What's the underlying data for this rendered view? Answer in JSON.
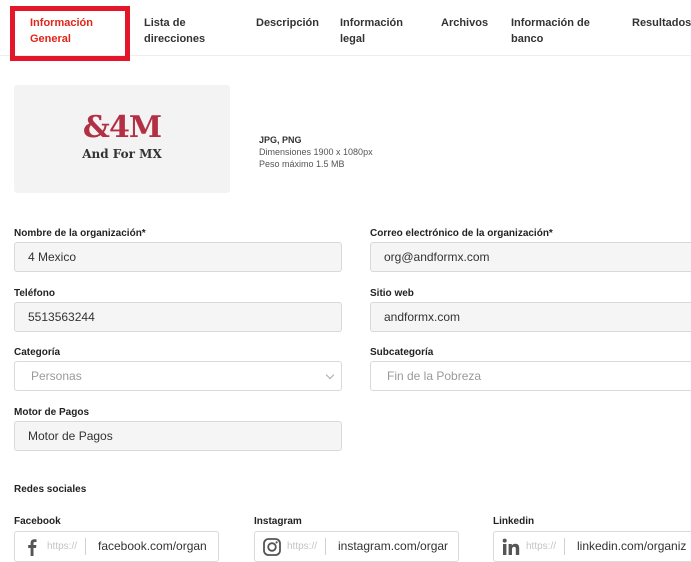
{
  "tabs": [
    {
      "line1": "Información",
      "line2": "General"
    },
    {
      "line1": "Lista de",
      "line2": "direcciones"
    },
    {
      "line1": "Descripción",
      "line2": ""
    },
    {
      "line1": "Información",
      "line2": "legal"
    },
    {
      "line1": "Archivos",
      "line2": ""
    },
    {
      "line1": "Información de",
      "line2": "banco"
    },
    {
      "line1": "Resultados",
      "line2": ""
    }
  ],
  "logo": {
    "mark": "&4M",
    "subtitle": "And For MX"
  },
  "file_info": {
    "formats": "JPG, PNG",
    "dimensions": "Dimensiones 1900 x 1080px",
    "max_size": "Peso máximo 1.5 MB"
  },
  "form": {
    "org_name": {
      "label": "Nombre de la organización*",
      "value": "4 Mexico"
    },
    "org_email": {
      "label": "Correo electrónico de la organización*",
      "value": "org@andformx.com"
    },
    "phone": {
      "label": "Teléfono",
      "value": "5513563244"
    },
    "website": {
      "label": "Sitio web",
      "value": "andformx.com"
    },
    "category": {
      "label": "Categoría",
      "value": "Personas"
    },
    "subcategory": {
      "label": "Subcategoría",
      "value": "Fin de la Pobreza"
    },
    "payment_engine": {
      "label": "Motor de Pagos",
      "value": "Motor de Pagos"
    }
  },
  "social": {
    "title": "Redes sociales",
    "facebook": {
      "label": "Facebook",
      "prefix": "https://",
      "value": "facebook.com/organ"
    },
    "instagram": {
      "label": "Instagram",
      "prefix": "https://",
      "value": "instagram.com/orgar"
    },
    "linkedin": {
      "label": "Linkedin",
      "prefix": "https://",
      "value": "linkedin.com/organiz"
    }
  },
  "colors": {
    "accent": "#e0251b",
    "highlight": "#e3162a",
    "logo": "#b22f44"
  }
}
